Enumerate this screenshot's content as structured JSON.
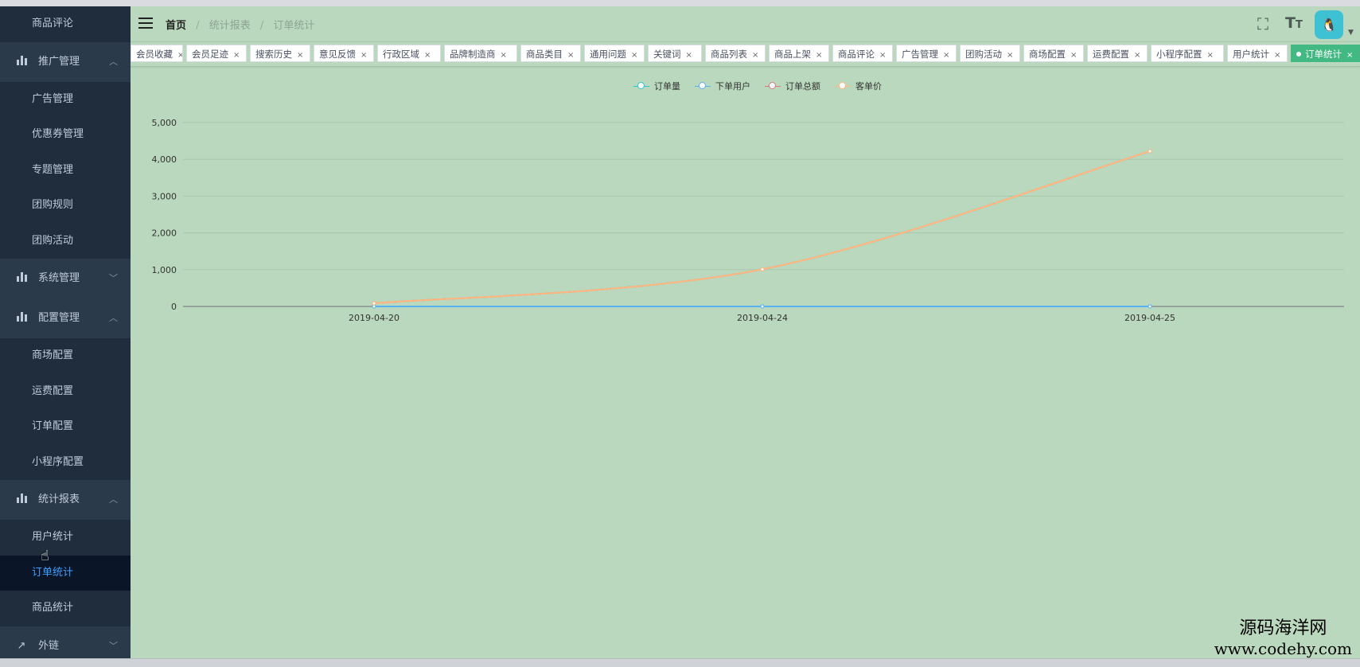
{
  "sidebar": {
    "items": [
      {
        "kind": "sub",
        "label": "商品评论"
      },
      {
        "kind": "group",
        "label": "推广管理",
        "icon": "bar-chart-icon",
        "chevron": "up"
      },
      {
        "kind": "sub",
        "label": "广告管理"
      },
      {
        "kind": "sub",
        "label": "优惠券管理"
      },
      {
        "kind": "sub",
        "label": "专题管理"
      },
      {
        "kind": "sub",
        "label": "团购规则"
      },
      {
        "kind": "sub",
        "label": "团购活动"
      },
      {
        "kind": "group",
        "label": "系统管理",
        "icon": "bar-chart-icon",
        "chevron": "down"
      },
      {
        "kind": "group",
        "label": "配置管理",
        "icon": "bar-chart-icon",
        "chevron": "up"
      },
      {
        "kind": "sub",
        "label": "商场配置"
      },
      {
        "kind": "sub",
        "label": "运费配置"
      },
      {
        "kind": "sub",
        "label": "订单配置"
      },
      {
        "kind": "sub",
        "label": "小程序配置"
      },
      {
        "kind": "group",
        "label": "统计报表",
        "icon": "bar-chart-icon",
        "chevron": "up"
      },
      {
        "kind": "sub",
        "label": "用户统计"
      },
      {
        "kind": "sub",
        "label": "订单统计",
        "active": true
      },
      {
        "kind": "sub",
        "label": "商品统计"
      },
      {
        "kind": "group",
        "label": "外链",
        "icon": "external-link-icon",
        "chevron": "down"
      }
    ]
  },
  "header": {
    "breadcrumb": [
      "首页",
      "统计报表",
      "订单统计"
    ],
    "icons": [
      "fullscreen-icon",
      "font-size-icon"
    ],
    "avatar_icon": "user-avatar-icon"
  },
  "tags": [
    {
      "label": "会员收藏"
    },
    {
      "label": "会员足迹"
    },
    {
      "label": "搜索历史"
    },
    {
      "label": "意见反馈"
    },
    {
      "label": "行政区域"
    },
    {
      "label": "品牌制造商"
    },
    {
      "label": "商品类目"
    },
    {
      "label": "通用问题"
    },
    {
      "label": "关键词"
    },
    {
      "label": "商品列表"
    },
    {
      "label": "商品上架"
    },
    {
      "label": "商品评论"
    },
    {
      "label": "广告管理"
    },
    {
      "label": "团购活动"
    },
    {
      "label": "商场配置"
    },
    {
      "label": "运费配置"
    },
    {
      "label": "小程序配置"
    },
    {
      "label": "用户统计"
    },
    {
      "label": "订单统计",
      "active": true
    }
  ],
  "colors": {
    "accent": "#42b983",
    "sidebar_bg": "#1f2d3d",
    "content_bg": "#b9d8bd"
  },
  "chart_data": {
    "type": "line",
    "x": [
      "2019-04-20",
      "2019-04-24",
      "2019-04-25"
    ],
    "series": [
      {
        "name": "订单量",
        "color": "#2ec7c9",
        "values": [
          1,
          1,
          1
        ]
      },
      {
        "name": "下单用户",
        "color": "#5ab1ef",
        "values": [
          1,
          1,
          1
        ]
      },
      {
        "name": "订单总额",
        "color": "#d87a80",
        "values": [
          85,
          1010,
          4220
        ]
      },
      {
        "name": "客单价",
        "color": "#ffb980",
        "values": [
          85,
          1010,
          4220
        ]
      }
    ],
    "ylim": [
      0,
      5000
    ],
    "yticks": [
      "0",
      "1,000",
      "2,000",
      "3,000",
      "4,000",
      "5,000"
    ],
    "grid": true,
    "legend_position": "top-center",
    "smooth": true
  },
  "watermark": {
    "line1": "源码海洋网",
    "line2": "www.codehy.com"
  }
}
